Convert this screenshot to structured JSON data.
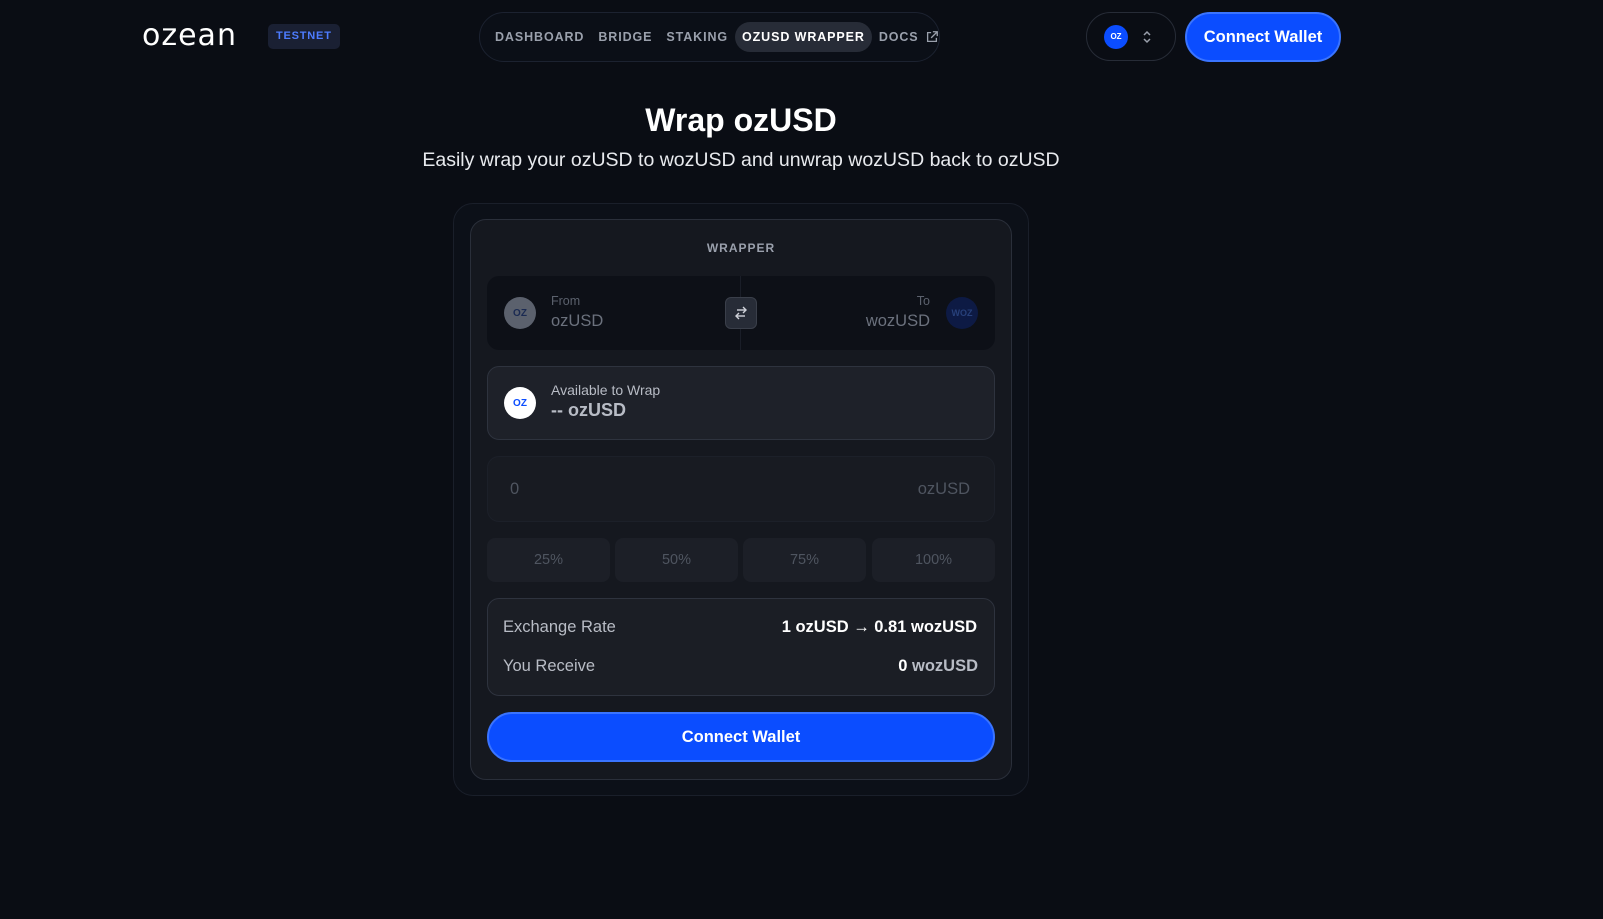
{
  "header": {
    "logo": "ozean",
    "badge": "TESTNET",
    "nav": [
      {
        "label": "DASHBOARD"
      },
      {
        "label": "BRIDGE"
      },
      {
        "label": "STAKING"
      },
      {
        "label": "OZUSD WRAPPER",
        "active": true
      },
      {
        "label": "DOCS",
        "icon": "external-link-icon"
      }
    ],
    "chain_icon_text": "OZ",
    "connect_label": "Connect Wallet"
  },
  "page": {
    "title": "Wrap ozUSD",
    "subtitle": "Easily wrap your ozUSD to wozUSD and unwrap wozUSD back to ozUSD"
  },
  "wrapper": {
    "label": "WRAPPER",
    "from": {
      "label": "From",
      "token": "ozUSD",
      "icon_text": "OZ"
    },
    "to": {
      "label": "To",
      "token": "wozUSD",
      "icon_text": "WOZ"
    },
    "available": {
      "label": "Available to Wrap",
      "value": "-- ozUSD",
      "icon_text": "OZ"
    },
    "amount": {
      "placeholder": "0",
      "unit": "ozUSD"
    },
    "percent_buttons": [
      "25%",
      "50%",
      "75%",
      "100%"
    ],
    "exchange_rate": {
      "label": "Exchange Rate",
      "value": "1 ozUSD → 0.81 wozUSD"
    },
    "receive": {
      "label": "You Receive",
      "amount": "0",
      "unit": "wozUSD"
    },
    "connect_label": "Connect Wallet"
  },
  "colors": {
    "background": "#0a0d14",
    "accent": "#0b4dff",
    "card": "#15181f",
    "muted_text": "#9aa0ac"
  }
}
